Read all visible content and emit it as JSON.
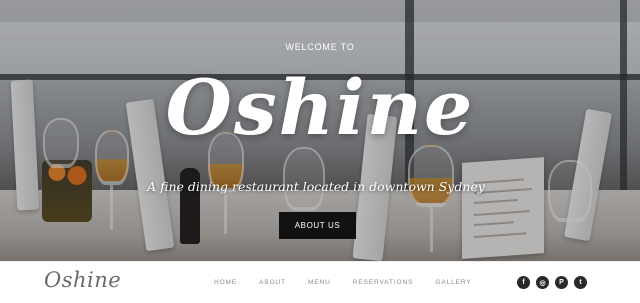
{
  "hero": {
    "welcome": "WELCOME TO",
    "brand": "Oshine",
    "tagline": "A fine dining restaurant located in downtown Sydney",
    "cta_label": "ABOUT US"
  },
  "nav": {
    "logo": "Oshine",
    "links": [
      "HOME",
      "ABOUT",
      "MENU",
      "RESERVATIONS",
      "GALLERY"
    ]
  },
  "social": [
    {
      "icon": "facebook-icon",
      "glyph": "f"
    },
    {
      "icon": "instagram-icon",
      "glyph": "◎"
    },
    {
      "icon": "pinterest-icon",
      "glyph": "P"
    },
    {
      "icon": "twitter-icon",
      "glyph": "t"
    }
  ],
  "colors": {
    "button_bg": "#111111",
    "nav_text": "#8b8b8b",
    "logo_text": "#6a6a6a",
    "social_bg": "#2a2a2a"
  }
}
